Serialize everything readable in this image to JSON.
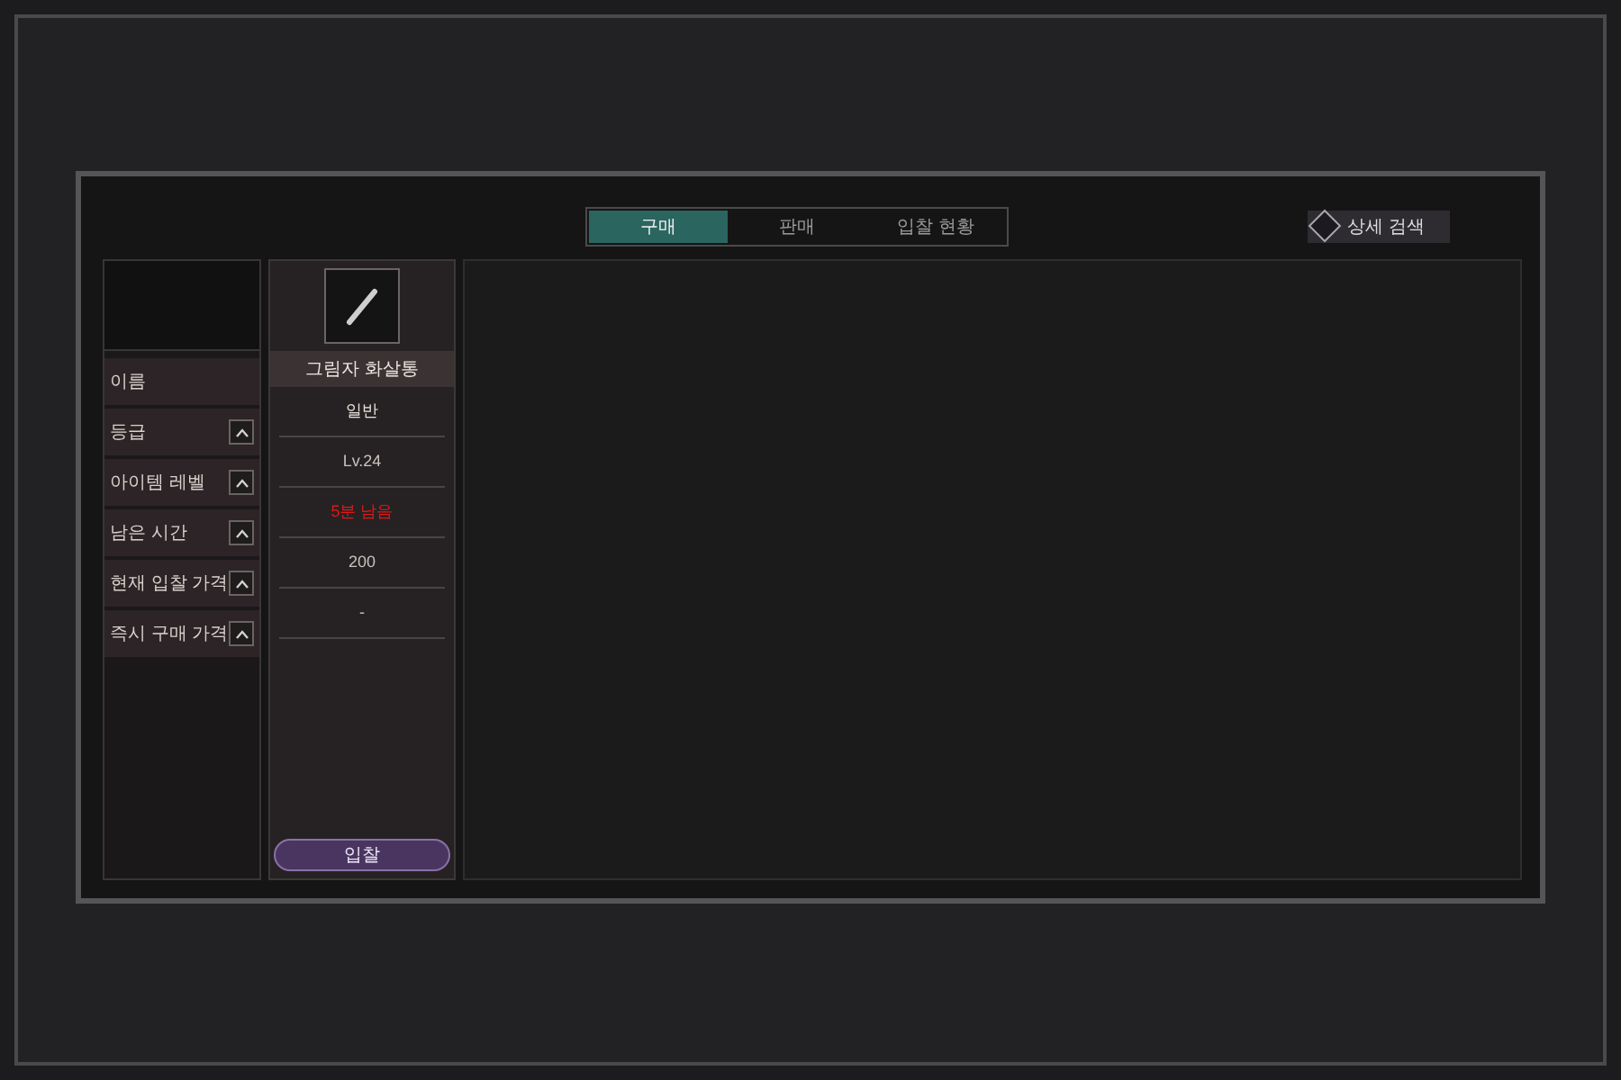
{
  "tabs": [
    {
      "label": "구매",
      "selected": true
    },
    {
      "label": "판매",
      "selected": false
    },
    {
      "label": "입찰 현황",
      "selected": false
    }
  ],
  "detail_search_button": "상세 검색",
  "columns": [
    {
      "label": "이름",
      "kind": "label"
    },
    {
      "label": "등급",
      "kind": "sort"
    },
    {
      "label": "아이템 레벨",
      "kind": "sort"
    },
    {
      "label": "남은 시간",
      "kind": "sort"
    },
    {
      "label": "현재 입찰 가격",
      "kind": "sort"
    },
    {
      "label": "즉시 구매 가격",
      "kind": "sort"
    }
  ],
  "item": {
    "name": "그림자 화살통",
    "fields": [
      {
        "value": "일반",
        "color": "#e8e2dc"
      },
      {
        "value": "Lv.24",
        "color": "#c8c2bc"
      },
      {
        "value": "5분 남음",
        "color": "#e01818"
      },
      {
        "value": "200",
        "color": "#c8c2bc"
      },
      {
        "value": "-",
        "color": "#c8c2bc"
      }
    ],
    "bid_button": "입찰"
  }
}
